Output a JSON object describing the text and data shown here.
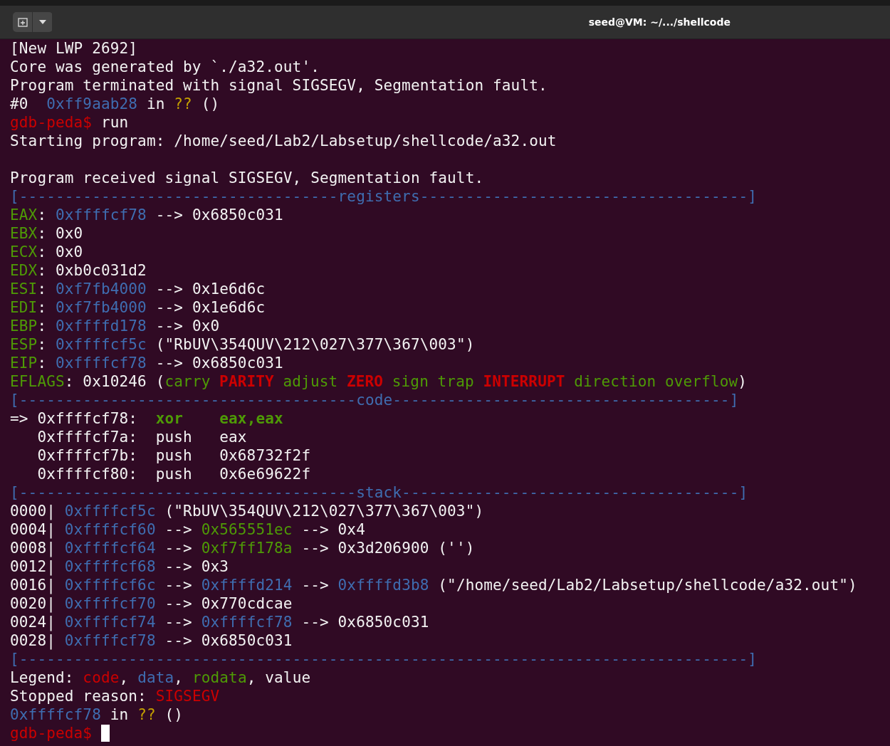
{
  "window": {
    "title": "seed@VM: ~/.../shellcode"
  },
  "terminal": {
    "lines": [
      {
        "kind": "text",
        "segments": [
          {
            "text": "[New LWP 2692]",
            "kind": "plain"
          }
        ]
      },
      {
        "kind": "text",
        "segments": [
          {
            "text": "Core was generated by `./a32.out'.",
            "kind": "plain"
          }
        ]
      },
      {
        "kind": "text",
        "segments": [
          {
            "text": "Program terminated with signal SIGSEGV, Segmentation fault.",
            "kind": "plain"
          }
        ]
      },
      {
        "kind": "text",
        "segments": [
          {
            "text": "#0  ",
            "kind": "plain"
          },
          {
            "text": "0xff9aab28",
            "kind": "data"
          },
          {
            "text": " in ",
            "kind": "plain"
          },
          {
            "text": "??",
            "kind": "unknown"
          },
          {
            "text": " ()",
            "kind": "plain"
          }
        ]
      },
      {
        "kind": "text",
        "segments": [
          {
            "text": "gdb-peda$",
            "kind": "prompt"
          },
          {
            "text": " run",
            "kind": "plain"
          }
        ]
      },
      {
        "kind": "text",
        "segments": [
          {
            "text": "Starting program: /home/seed/Lab2/Labsetup/shellcode/a32.out",
            "kind": "plain"
          }
        ]
      },
      {
        "kind": "blank"
      },
      {
        "kind": "text",
        "segments": [
          {
            "text": "Program received signal SIGSEGV, Segmentation fault.",
            "kind": "plain"
          }
        ]
      },
      {
        "kind": "text",
        "segments": [
          {
            "text": "[-----------------------------------registers------------------------------------]",
            "kind": "rule"
          }
        ]
      },
      {
        "kind": "text",
        "segments": [
          {
            "text": "EAX",
            "kind": "reg"
          },
          {
            "text": ": ",
            "kind": "plain"
          },
          {
            "text": "0xffffcf78",
            "kind": "data"
          },
          {
            "text": " --> 0x6850c031",
            "kind": "plain"
          }
        ]
      },
      {
        "kind": "text",
        "segments": [
          {
            "text": "EBX",
            "kind": "reg"
          },
          {
            "text": ": 0x0",
            "kind": "plain"
          }
        ]
      },
      {
        "kind": "text",
        "segments": [
          {
            "text": "ECX",
            "kind": "reg"
          },
          {
            "text": ": 0x0",
            "kind": "plain"
          }
        ]
      },
      {
        "kind": "text",
        "segments": [
          {
            "text": "EDX",
            "kind": "reg"
          },
          {
            "text": ": 0xb0c031d2",
            "kind": "plain"
          }
        ]
      },
      {
        "kind": "text",
        "segments": [
          {
            "text": "ESI",
            "kind": "reg"
          },
          {
            "text": ": ",
            "kind": "plain"
          },
          {
            "text": "0xf7fb4000",
            "kind": "data"
          },
          {
            "text": " --> 0x1e6d6c",
            "kind": "plain"
          }
        ]
      },
      {
        "kind": "text",
        "segments": [
          {
            "text": "EDI",
            "kind": "reg"
          },
          {
            "text": ": ",
            "kind": "plain"
          },
          {
            "text": "0xf7fb4000",
            "kind": "data"
          },
          {
            "text": " --> 0x1e6d6c",
            "kind": "plain"
          }
        ]
      },
      {
        "kind": "text",
        "segments": [
          {
            "text": "EBP",
            "kind": "reg"
          },
          {
            "text": ": ",
            "kind": "plain"
          },
          {
            "text": "0xffffd178",
            "kind": "data"
          },
          {
            "text": " --> 0x0",
            "kind": "plain"
          }
        ]
      },
      {
        "kind": "text",
        "segments": [
          {
            "text": "ESP",
            "kind": "reg"
          },
          {
            "text": ": ",
            "kind": "plain"
          },
          {
            "text": "0xffffcf5c",
            "kind": "data"
          },
          {
            "text": " (\"RbUV\\354QUV\\212\\027\\377\\367\\003\")",
            "kind": "plain"
          }
        ]
      },
      {
        "kind": "text",
        "segments": [
          {
            "text": "EIP",
            "kind": "reg"
          },
          {
            "text": ": ",
            "kind": "plain"
          },
          {
            "text": "0xffffcf78",
            "kind": "data"
          },
          {
            "text": " --> 0x6850c031",
            "kind": "plain"
          }
        ]
      },
      {
        "kind": "text",
        "segments": [
          {
            "text": "EFLAGS",
            "kind": "reg"
          },
          {
            "text": ": 0x10246 (",
            "kind": "plain"
          },
          {
            "text": "carry",
            "kind": "flag_off"
          },
          {
            "text": "PARITY",
            "kind": "flag_on"
          },
          {
            "text": "adjust",
            "kind": "flag_off"
          },
          {
            "text": "ZERO",
            "kind": "flag_on"
          },
          {
            "text": "sign",
            "kind": "flag_off"
          },
          {
            "text": "trap",
            "kind": "flag_off"
          },
          {
            "text": "INTERRUPT",
            "kind": "flag_on"
          },
          {
            "text": "direction",
            "kind": "flag_off"
          },
          {
            "text": "overflow",
            "kind": "flag_off"
          },
          {
            "text": ")",
            "kind": "plain"
          }
        ]
      },
      {
        "kind": "text",
        "segments": [
          {
            "text": "[-------------------------------------code-------------------------------------]",
            "kind": "rule"
          }
        ]
      },
      {
        "kind": "text",
        "segments": [
          {
            "text": "=> 0xffffcf78:  ",
            "kind": "plain"
          },
          {
            "text": "xor    eax,eax",
            "kind": "instr"
          }
        ]
      },
      {
        "kind": "text",
        "segments": [
          {
            "text": "   0xffffcf7a:  push   eax",
            "kind": "plain"
          }
        ]
      },
      {
        "kind": "text",
        "segments": [
          {
            "text": "   0xffffcf7b:  push   0x68732f2f",
            "kind": "plain"
          }
        ]
      },
      {
        "kind": "text",
        "segments": [
          {
            "text": "   0xffffcf80:  push   0x6e69622f",
            "kind": "plain"
          }
        ]
      },
      {
        "kind": "text",
        "segments": [
          {
            "text": "[-------------------------------------stack-------------------------------------]",
            "kind": "rule"
          }
        ]
      },
      {
        "kind": "text",
        "segments": [
          {
            "text": "0000| ",
            "kind": "plain"
          },
          {
            "text": "0xffffcf5c",
            "kind": "data"
          },
          {
            "text": " (\"RbUV\\354QUV\\212\\027\\377\\367\\003\")",
            "kind": "plain"
          }
        ]
      },
      {
        "kind": "text",
        "segments": [
          {
            "text": "0004| ",
            "kind": "plain"
          },
          {
            "text": "0xffffcf60",
            "kind": "data"
          },
          {
            "text": " --> ",
            "kind": "plain"
          },
          {
            "text": "0x565551ec",
            "kind": "rodata"
          },
          {
            "text": " --> 0x4",
            "kind": "plain"
          }
        ]
      },
      {
        "kind": "text",
        "segments": [
          {
            "text": "0008| ",
            "kind": "plain"
          },
          {
            "text": "0xffffcf64",
            "kind": "data"
          },
          {
            "text": " --> ",
            "kind": "plain"
          },
          {
            "text": "0xf7ff178a",
            "kind": "rodata"
          },
          {
            "text": " --> 0x3d206900 ('')",
            "kind": "plain"
          }
        ]
      },
      {
        "kind": "text",
        "segments": [
          {
            "text": "0012| ",
            "kind": "plain"
          },
          {
            "text": "0xffffcf68",
            "kind": "data"
          },
          {
            "text": " --> 0x3",
            "kind": "plain"
          }
        ]
      },
      {
        "kind": "text",
        "segments": [
          {
            "text": "0016| ",
            "kind": "plain"
          },
          {
            "text": "0xffffcf6c",
            "kind": "data"
          },
          {
            "text": " --> ",
            "kind": "plain"
          },
          {
            "text": "0xffffd214",
            "kind": "data"
          },
          {
            "text": " --> ",
            "kind": "plain"
          },
          {
            "text": "0xffffd3b8",
            "kind": "data"
          },
          {
            "text": " (\"/home/seed/Lab2/Labsetup/shellcode/a32.out\")",
            "kind": "plain"
          }
        ]
      },
      {
        "kind": "text",
        "segments": [
          {
            "text": "0020| ",
            "kind": "plain"
          },
          {
            "text": "0xffffcf70",
            "kind": "data"
          },
          {
            "text": " --> 0x770cdcae",
            "kind": "plain"
          }
        ]
      },
      {
        "kind": "text",
        "segments": [
          {
            "text": "0024| ",
            "kind": "plain"
          },
          {
            "text": "0xffffcf74",
            "kind": "data"
          },
          {
            "text": " --> ",
            "kind": "plain"
          },
          {
            "text": "0xffffcf78",
            "kind": "data"
          },
          {
            "text": " --> 0x6850c031",
            "kind": "plain"
          }
        ]
      },
      {
        "kind": "text",
        "segments": [
          {
            "text": "0028| ",
            "kind": "plain"
          },
          {
            "text": "0xffffcf78",
            "kind": "data"
          },
          {
            "text": " --> 0x6850c031",
            "kind": "plain"
          }
        ]
      },
      {
        "kind": "text",
        "segments": [
          {
            "text": "[--------------------------------------------------------------------------------]",
            "kind": "rule"
          }
        ]
      },
      {
        "kind": "text",
        "segments": [
          {
            "text": "Legend: ",
            "kind": "plain"
          },
          {
            "text": "code",
            "kind": "code"
          },
          {
            "text": ", ",
            "kind": "plain"
          },
          {
            "text": "data",
            "kind": "data"
          },
          {
            "text": ", ",
            "kind": "plain"
          },
          {
            "text": "rodata",
            "kind": "rodata"
          },
          {
            "text": ", value",
            "kind": "plain"
          }
        ]
      },
      {
        "kind": "text",
        "segments": [
          {
            "text": "Stopped reason: ",
            "kind": "plain"
          },
          {
            "text": "SIGSEGV",
            "kind": "code"
          }
        ]
      },
      {
        "kind": "text",
        "segments": [
          {
            "text": "0xffffcf78",
            "kind": "data"
          },
          {
            "text": " in ",
            "kind": "plain"
          },
          {
            "text": "??",
            "kind": "unknown"
          },
          {
            "text": " ()",
            "kind": "plain"
          }
        ]
      }
    ],
    "prompt": {
      "text": "gdb-peda$",
      "cursor": true
    }
  }
}
